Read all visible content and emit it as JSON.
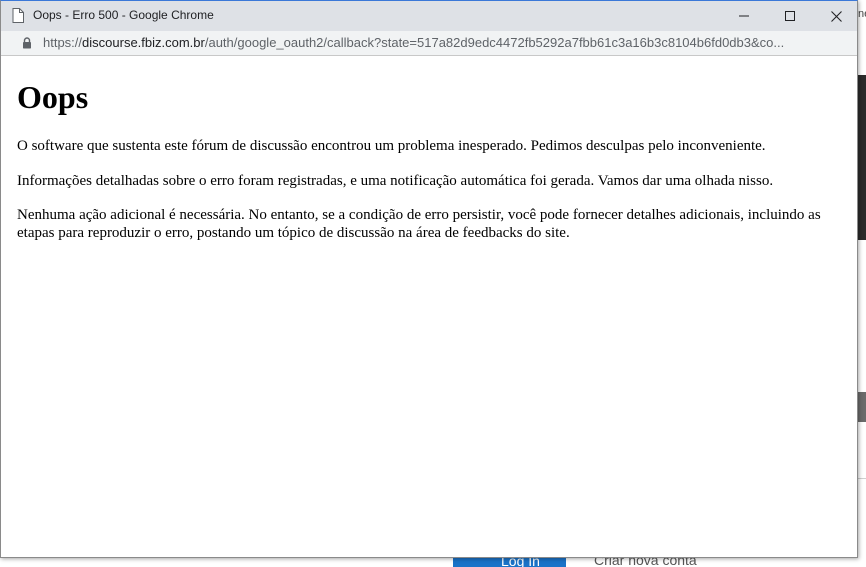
{
  "background": {
    "corner_text": "ne",
    "login_label": "Log In",
    "signup_label": "Criar nova conta"
  },
  "window": {
    "title": "Oops - Erro 500 - Google Chrome",
    "controls": {
      "minimize_icon": "minimize-icon",
      "maximize_icon": "maximize-icon",
      "close_icon": "close-icon"
    }
  },
  "address_bar": {
    "scheme": "https://",
    "host": "discourse.fbiz.com.br",
    "path": "/auth/google_oauth2/callback?state=517a82d9edc4472fb5292a7fbb61c3a16b3c8104b6fd0db3&co..."
  },
  "page": {
    "heading": "Oops",
    "paragraphs": [
      "O software que sustenta este fórum de discussão encontrou um problema inesperado. Pedimos desculpas pelo inconveniente.",
      "Informações detalhadas sobre o erro foram registradas, e uma notificação automática foi gerada. Vamos dar uma olhada nisso.",
      "Nenhuma ação adicional é necessária. No entanto, se a condição de erro persistir, você pode fornecer detalhes adicionais, incluindo as etapas para reproduzir o erro, postando um tópico de discussão na área de feedbacks do site."
    ]
  },
  "colors": {
    "titlebar": "#dee1e6",
    "addressbar": "#f1f3f4",
    "background_button": "#1a73c8",
    "background_dark_bar": "#2b2b2b"
  }
}
